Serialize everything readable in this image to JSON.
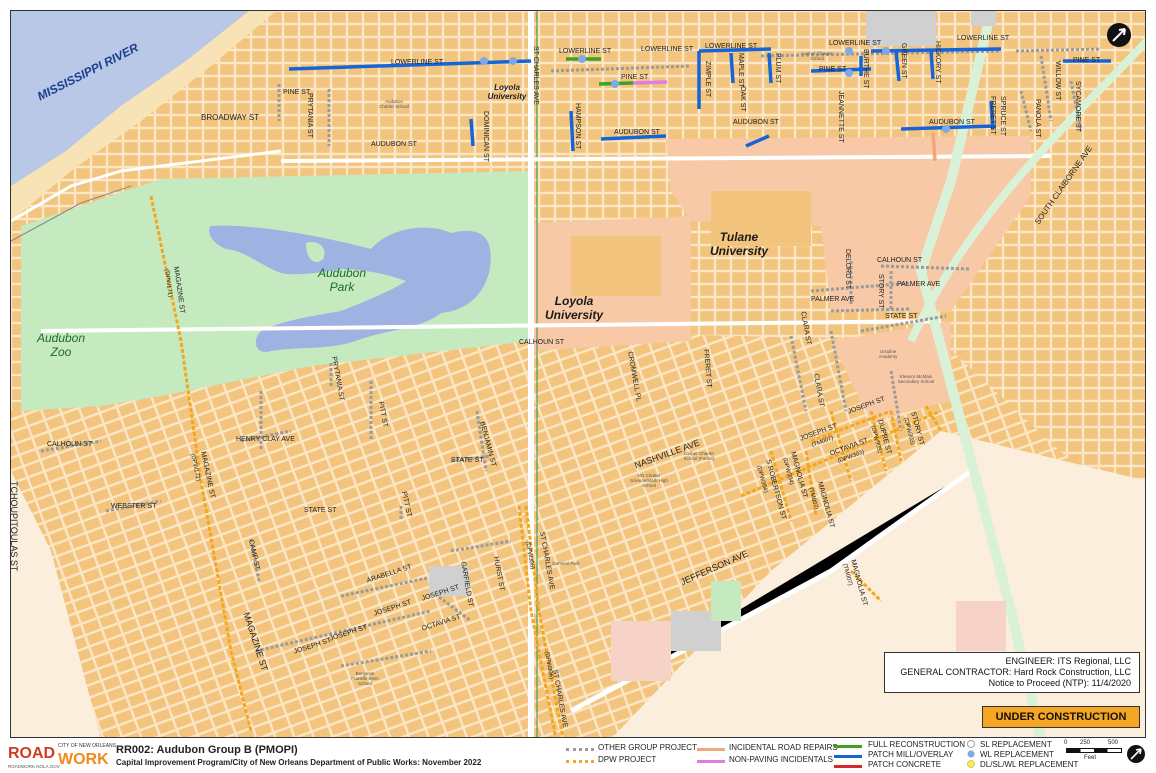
{
  "map": {
    "waters": {
      "river": "MISSISSIPPI RIVER"
    },
    "places": {
      "loyola_small": "Loyola University",
      "loyola_big": "Loyola University",
      "tulane": "Tulane University",
      "audubon_park": "Audubon Park",
      "audubon_zoo": "Audubon Zoo"
    },
    "streets": {
      "lowerline_1": "LOWERLINE ST",
      "lowerline_2": "LOWERLINE ST",
      "lowerline_3": "LOWERLINE ST",
      "lowerline_4": "LOWERLINE ST",
      "lowerline_5": "LOWERLINE ST",
      "lowerline_6": "LOWERLINE ST",
      "pine_1": "PINE ST",
      "pine_2": "PINE ST",
      "pine_3": "PINE ST",
      "pine_4": "PINE ST",
      "broadway": "BROADWAY ST",
      "prytania_1": "PRYTANIA ST",
      "prytania_2": "PRYTANIA ST",
      "audubon_1": "AUDUBON ST",
      "audubon_2": "AUDUBON ST",
      "audubon_3": "AUDUBON ST",
      "audubon_4": "AUDUBON ST",
      "dominican": "DOMINICAN ST",
      "st_charles_top": "ST CHARLES AVE",
      "hampson": "HAMPSON ST",
      "zimple": "ZIMPLE ST",
      "oak": "OAK ST",
      "maple": "MAPLE ST",
      "willow": "WILLOW ST",
      "plum": "PLUM ST",
      "jeannette": "JEANNETTE ST",
      "burthe": "BURTHE ST",
      "green": "GREEN ST",
      "hickory": "HICKORY ST",
      "spruce": "SPRUCE ST",
      "freret_top": "FRERET ST",
      "panola": "PANOLA ST",
      "sycamore": "SYCAMORE ST",
      "south_claiborne": "SOUTH CLAIBORNE AVE",
      "delord": "DELORD ST",
      "calhoun_1": "CALHOUN ST",
      "calhoun_2": "CALHOUN ST",
      "calhoun_3": "CALHOUN ST",
      "story_1": "STORY ST",
      "palmer_1": "PALMER AVE",
      "palmer_2": "PALMER AVE",
      "state_1": "STATE ST",
      "state_2": "STATE ST",
      "state_3": "STATE ST",
      "cromwell": "CROMWELL PL",
      "freret": "FRERET ST",
      "clara_1": "CLARA ST",
      "clara_2": "CLARA ST",
      "magazine_1": "MAGAZINE ST",
      "magazine_1b": "(DPW171)",
      "magazine_2": "MAGAZINE ST",
      "magazine_2b": "(DPW172)",
      "magazine_3": "MAGAZINE ST",
      "pitt_1": "PITT ST",
      "pitt_2": "PITT ST",
      "henry_clay": "HENRY CLAY AVE",
      "benjamin": "BENJAMIN ST",
      "webster": "WEBSTER ST",
      "camp": "CAMP ST",
      "arabella": "ARABELLA ST",
      "joseph_1": "JOSEPH ST",
      "joseph_2": "JOSEPH ST",
      "joseph_3": "JOSEPH ST",
      "garfield": "GARFIELD ST",
      "hurst": "HURST ST",
      "octavia_1": "OCTAVIA ST",
      "st_charles_1": "ST CHARLES AVE",
      "st_charles_1b": "(DPW306)",
      "st_charles_2": "ST CHARLES AVE",
      "st_charles_2b": "(DPW306)",
      "tchoupitoulas": "TCHOUPITOULAS ST",
      "jefferson": "JEFFERSON AVE",
      "nashville": "NASHVILLE AVE",
      "joseph_4": "JOSEPH ST",
      "joseph_4b": "(TM007)",
      "octavia_2": "OCTAVIA ST",
      "octavia_2b": "(DPW303)",
      "robertson": "S ROBERTSON ST",
      "robertson_b": "(DPW304)",
      "magnolia_1": "MAGNOLIA ST",
      "magnolia_1b": "(DPW304)",
      "magnolia_2": "MAGNOLIA ST",
      "magnolia_2b": "(TM007)",
      "dupre": "DUPRE ST",
      "dupre_b": "(DPW303)",
      "joseph_5": "JOSEPH ST",
      "story_2": "STORY ST",
      "story_2b": "(DPW303)",
      "magnolia_3": "MAGNOLIA ST",
      "magnolia_3b": "(TM007)"
    },
    "schools": {
      "s1": "Audubon Charter School",
      "s2": "Audubon Charter School",
      "s3": "Lusher Charter School",
      "s4": "Ursuline Academy",
      "s5": "Eleanor McMain Secondary School",
      "s6": "Lusher Charter School (Fortier)",
      "s7": "NO Charter Science/Math High School",
      "s8": "Benjamin Franklin Elem School",
      "s9": "Danneel Park"
    }
  },
  "info": {
    "engineer": "ENGINEER:  ITS Regional, LLC",
    "contractor": "GENERAL CONTRACTOR:  Hard Rock Construction, LLC",
    "ntp": "Notice to Proceed (NTP):  11/4/2020"
  },
  "status_label": "UNDER CONSTRUCTION",
  "footer": {
    "logo_road": "ROAD",
    "logo_work": "WORK",
    "logo_city": "CITY OF NEW ORLEANS",
    "logo_tag": "ROADWORK.NOLA.GOV",
    "title": "RR002:  Audubon Group B (PMOPI)",
    "subtitle": "Capital Improvement Program/City of New Orleans Department of Public Works:  November 2022",
    "legend": {
      "other_group": "OTHER GROUP PROJECT",
      "dpw": "DPW PROJECT",
      "incidental": "INCIDENTAL ROAD REPAIRS",
      "non_paving": "NON-PAVING INCIDENTALS",
      "full_recon": "FULL RECONSTRUCTION",
      "patch_mill": "PATCH MILL/OVERLAY",
      "patch_concrete": "PATCH CONCRETE",
      "sl": "SL REPLACEMENT",
      "wl": "WL REPLACEMENT",
      "dl": "DL/SL/WL REPLACEMENT"
    },
    "scale": {
      "zero": "0",
      "mid": "250",
      "max": "500",
      "unit": "Feet"
    }
  },
  "colors": {
    "land": "#fbe7c6",
    "block": "#f2c47e",
    "street": "#ffffff",
    "park": "#c6eac0",
    "river": "#b9c8e6",
    "lake": "#9fb3e3",
    "sand": "#f7e3b5",
    "campus": "#f8c9a6",
    "patch_mill": "#1665d8",
    "full_recon": "#3aa321",
    "non_paving": "#e27be5",
    "incidental": "#f0a77a",
    "dpw": "#f2a71f",
    "other_group": "#9b9b9b",
    "wl": "#7fa9e6",
    "dl": "#f7ef3a",
    "status": "#f5a623",
    "logo_red": "#d23b22",
    "logo_orange": "#f08a1c"
  }
}
